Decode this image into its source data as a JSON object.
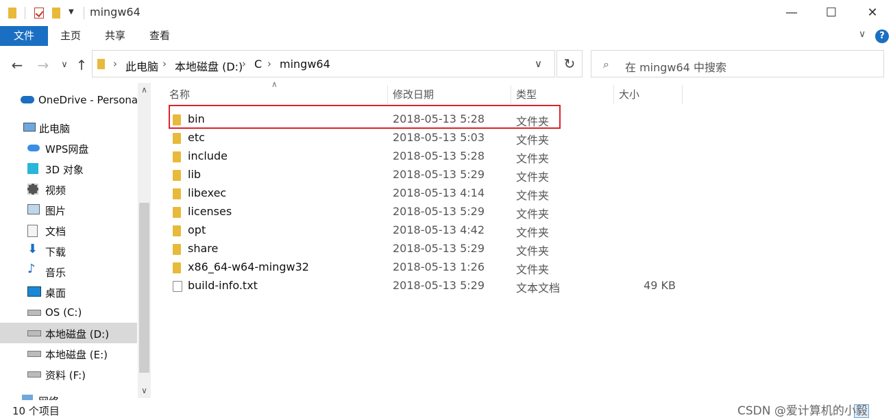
{
  "window": {
    "title": "mingw64",
    "controls": {
      "minimize": "—",
      "maximize": "☐",
      "close": "✕"
    }
  },
  "ribbon": {
    "tabs": [
      "文件",
      "主页",
      "共享",
      "查看"
    ]
  },
  "address": {
    "crumbs": [
      "此电脑",
      "本地磁盘 (D:)",
      "C",
      "mingw64"
    ]
  },
  "search": {
    "placeholder": "在 mingw64 中搜索"
  },
  "sidebar": {
    "items": [
      {
        "label": "OneDrive - Personal",
        "icon": "cloud-icon"
      },
      {
        "label": "此电脑",
        "icon": "computer-icon"
      },
      {
        "label": "WPS网盘",
        "icon": "cloud-drive-icon"
      },
      {
        "label": "3D 对象",
        "icon": "cube-icon"
      },
      {
        "label": "视频",
        "icon": "video-icon"
      },
      {
        "label": "图片",
        "icon": "pictures-icon"
      },
      {
        "label": "文档",
        "icon": "document-icon"
      },
      {
        "label": "下载",
        "icon": "download-icon"
      },
      {
        "label": "音乐",
        "icon": "music-icon"
      },
      {
        "label": "桌面",
        "icon": "desktop-icon"
      },
      {
        "label": "OS (C:)",
        "icon": "drive-icon"
      },
      {
        "label": "本地磁盘 (D:)",
        "icon": "drive-icon",
        "selected": true
      },
      {
        "label": "本地磁盘 (E:)",
        "icon": "drive-icon"
      },
      {
        "label": "资料 (F:)",
        "icon": "drive-icon"
      },
      {
        "label": "网络",
        "icon": "network-icon"
      }
    ]
  },
  "columns": {
    "name": "名称",
    "date": "修改日期",
    "type": "类型",
    "size": "大小"
  },
  "files": [
    {
      "name": "bin",
      "date": "2018-05-13 5:28",
      "type": "文件夹",
      "size": "",
      "kind": "folder",
      "highlighted": true
    },
    {
      "name": "etc",
      "date": "2018-05-13 5:03",
      "type": "文件夹",
      "size": "",
      "kind": "folder"
    },
    {
      "name": "include",
      "date": "2018-05-13 5:28",
      "type": "文件夹",
      "size": "",
      "kind": "folder"
    },
    {
      "name": "lib",
      "date": "2018-05-13 5:29",
      "type": "文件夹",
      "size": "",
      "kind": "folder"
    },
    {
      "name": "libexec",
      "date": "2018-05-13 4:14",
      "type": "文件夹",
      "size": "",
      "kind": "folder"
    },
    {
      "name": "licenses",
      "date": "2018-05-13 5:29",
      "type": "文件夹",
      "size": "",
      "kind": "folder"
    },
    {
      "name": "opt",
      "date": "2018-05-13 4:42",
      "type": "文件夹",
      "size": "",
      "kind": "folder"
    },
    {
      "name": "share",
      "date": "2018-05-13 5:29",
      "type": "文件夹",
      "size": "",
      "kind": "folder"
    },
    {
      "name": "x86_64-w64-mingw32",
      "date": "2018-05-13 1:26",
      "type": "文件夹",
      "size": "",
      "kind": "folder"
    },
    {
      "name": "build-info.txt",
      "date": "2018-05-13 5:29",
      "type": "文本文档",
      "size": "49 KB",
      "kind": "text"
    }
  ],
  "status": {
    "item_count": "10 个项目"
  },
  "watermark": "CSDN @爱计算机的小毅",
  "colors": {
    "accent": "#1a6fc2",
    "highlight_box": "#d9232d",
    "folder": "#e8b93a"
  }
}
